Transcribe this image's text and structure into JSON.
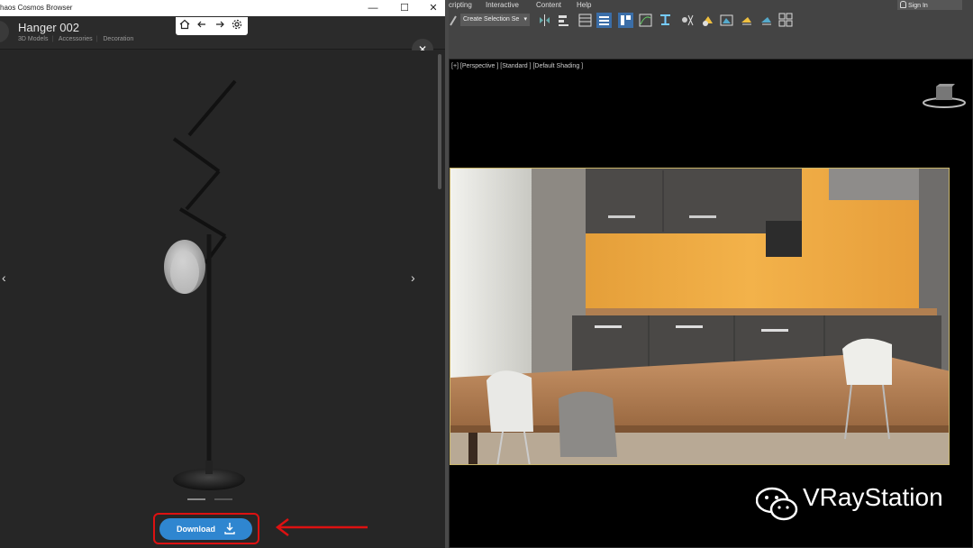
{
  "cosmos": {
    "window_title": "haos Cosmos Browser",
    "win_minimize": "—",
    "win_maximize": "☐",
    "win_close": "✕",
    "model_name": "Hanger 002",
    "breadcrumb": [
      "3D Models",
      "Accessories",
      "Decoration"
    ],
    "prev_glyph": "‹",
    "next_glyph": "›",
    "close_glyph": "✕",
    "download_label": "Download",
    "icons": [
      "home-icon",
      "arrow-left-icon",
      "arrow-right-icon",
      "gear-icon",
      "download-icon",
      "close-icon"
    ]
  },
  "max": {
    "menu": [
      "cripting",
      "Interactive",
      "Content",
      "Help"
    ],
    "sign_in": "Sign In",
    "selection_set_placeholder": "Create Selection Se",
    "viewport_label": "[+] [Perspective ] [Standard ] [Default Shading ]"
  },
  "watermark": {
    "text": "VRayStation"
  },
  "colors": {
    "download_button": "#2f86d0",
    "highlight_red": "#d11111",
    "render_border": "#c9b56a",
    "backsplash": "#f3b24a"
  }
}
